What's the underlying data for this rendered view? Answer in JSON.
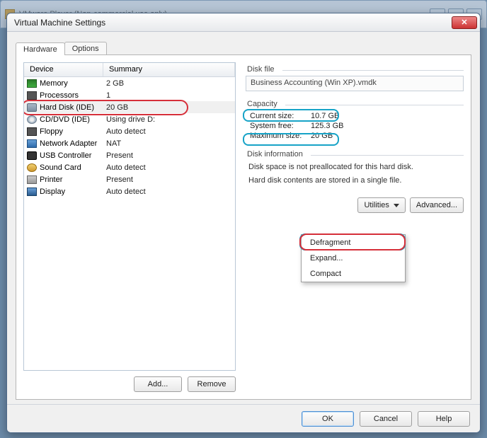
{
  "parent_title": "VMware Player (Non-commercial use only)",
  "dialog_title": "Virtual Machine Settings",
  "tabs": {
    "hardware": "Hardware",
    "options": "Options"
  },
  "list": {
    "header_device": "Device",
    "header_summary": "Summary",
    "rows": [
      {
        "icon": "ic-mem",
        "name": "Memory",
        "summary": "2 GB"
      },
      {
        "icon": "ic-cpu",
        "name": "Processors",
        "summary": "1"
      },
      {
        "icon": "ic-hdd",
        "name": "Hard Disk (IDE)",
        "summary": "20 GB",
        "selected": true
      },
      {
        "icon": "ic-cd",
        "name": "CD/DVD (IDE)",
        "summary": "Using drive D:"
      },
      {
        "icon": "ic-flop",
        "name": "Floppy",
        "summary": "Auto detect"
      },
      {
        "icon": "ic-net",
        "name": "Network Adapter",
        "summary": "NAT"
      },
      {
        "icon": "ic-usb",
        "name": "USB Controller",
        "summary": "Present"
      },
      {
        "icon": "ic-snd",
        "name": "Sound Card",
        "summary": "Auto detect"
      },
      {
        "icon": "ic-prn",
        "name": "Printer",
        "summary": "Present"
      },
      {
        "icon": "ic-dsp",
        "name": "Display",
        "summary": "Auto detect"
      }
    ]
  },
  "left_buttons": {
    "add": "Add...",
    "remove": "Remove"
  },
  "diskfile": {
    "group": "Disk file",
    "value": "Business Accounting (Win XP).vmdk"
  },
  "capacity": {
    "group": "Capacity",
    "current_lbl": "Current size:",
    "current_val": "10.7 GB",
    "free_lbl": "System free:",
    "free_val": "125.3 GB",
    "max_lbl": "Maximum size:",
    "max_val": "20 GB"
  },
  "diskinfo": {
    "group": "Disk information",
    "line1": "Disk space is not preallocated for this hard disk.",
    "line2": "Hard disk contents are stored in a single file."
  },
  "utilities": {
    "button": "Utilities",
    "advanced": "Advanced...",
    "menu": {
      "defragment": "Defragment",
      "expand": "Expand...",
      "compact": "Compact"
    }
  },
  "footer": {
    "ok": "OK",
    "cancel": "Cancel",
    "help": "Help"
  }
}
